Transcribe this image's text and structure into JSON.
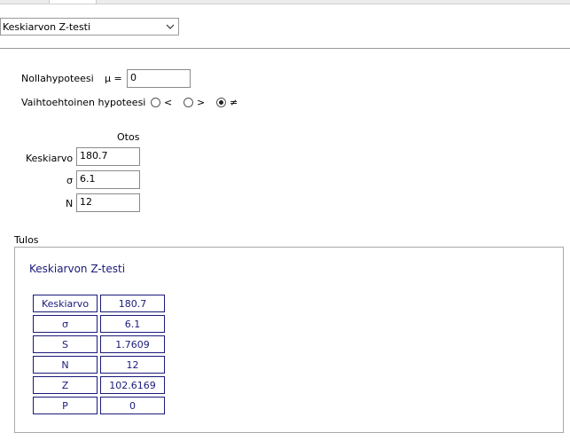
{
  "test_selector": {
    "selected": "Keskiarvon Z-testi"
  },
  "hypothesis": {
    "null_label": "Nollahypoteesi",
    "mu_label": "μ =",
    "mu_value": "0",
    "alt_label": "Vaihtoehtoinen hypoteesi",
    "options": [
      "<",
      ">",
      "≠"
    ],
    "selected_option": "≠"
  },
  "sample": {
    "header": "Otos",
    "rows": [
      {
        "label": "Keskiarvo",
        "value": "180.7"
      },
      {
        "label": "σ",
        "value": "6.1"
      },
      {
        "label": "N",
        "value": "12"
      }
    ]
  },
  "result": {
    "section_label": "Tulos",
    "title": "Keskiarvon Z-testi",
    "rows": [
      {
        "key": "Keskiarvo",
        "value": "180.7"
      },
      {
        "key": "σ",
        "value": "6.1"
      },
      {
        "key": "S",
        "value": "1.7609"
      },
      {
        "key": "N",
        "value": "12"
      },
      {
        "key": "Z",
        "value": "102.6169"
      },
      {
        "key": "P",
        "value": "0"
      }
    ]
  }
}
